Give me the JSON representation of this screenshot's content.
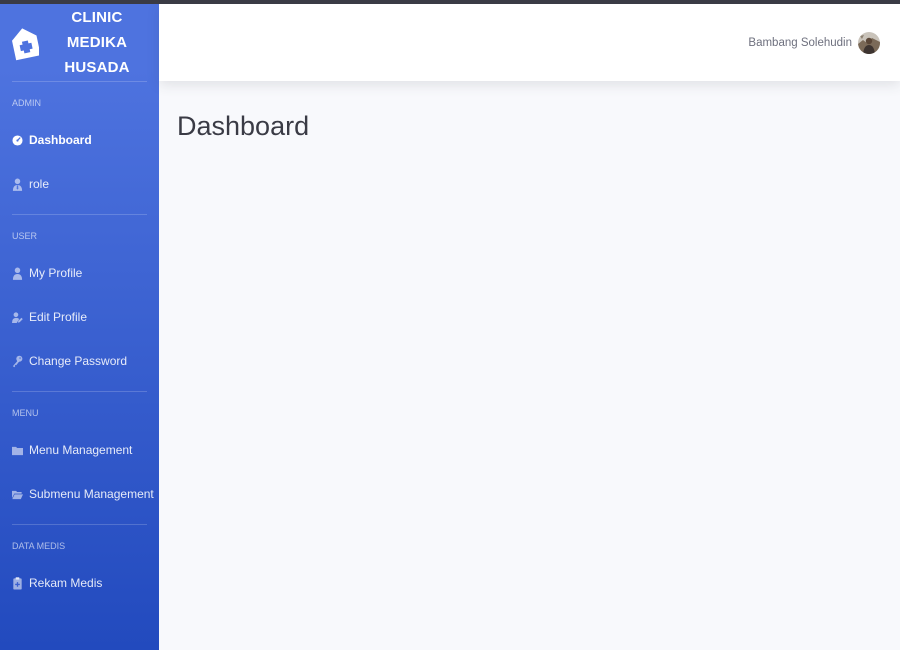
{
  "brand": {
    "line1": "CLINIC MEDIKA",
    "line2": "HUSADA",
    "icon": "clinic-house-icon"
  },
  "sidebar": {
    "sections": [
      {
        "heading": "ADMIN",
        "items": [
          {
            "label": "Dashboard",
            "icon": "tachometer-icon",
            "active": true
          },
          {
            "label": "role",
            "icon": "user-tie-icon"
          }
        ]
      },
      {
        "heading": "USER",
        "items": [
          {
            "label": "My Profile",
            "icon": "user-icon"
          },
          {
            "label": "Edit Profile",
            "icon": "user-edit-icon"
          },
          {
            "label": "Change Password",
            "icon": "key-icon"
          }
        ]
      },
      {
        "heading": "MENU",
        "items": [
          {
            "label": "Menu Management",
            "icon": "folder-icon"
          },
          {
            "label": "Submenu Management",
            "icon": "folder-open-icon"
          }
        ]
      },
      {
        "heading": "DATA MEDIS",
        "items": [
          {
            "label": "Rekam Medis",
            "icon": "file-medical-icon"
          }
        ]
      }
    ]
  },
  "topbar": {
    "user_name": "Bambang Solehudin",
    "avatar_icon": "user-avatar-photo"
  },
  "main": {
    "title": "Dashboard"
  },
  "colors": {
    "sidebar_top": "#4e73df",
    "sidebar_bottom": "#224abe",
    "page_bg": "#f8f9fc",
    "title": "#3a3b45",
    "topbar_text": "#6e707e"
  }
}
